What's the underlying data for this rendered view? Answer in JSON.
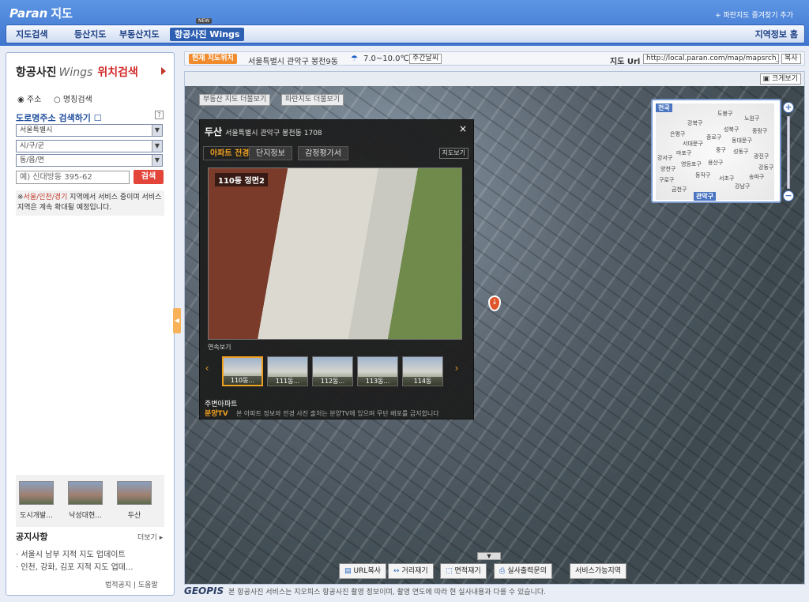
{
  "header": {
    "logo_brand": "Paran",
    "logo_suffix": "지도",
    "favorite_link": "+ 파란지도 즐겨찾기 추가",
    "nav": [
      "지도검색",
      "등산지도",
      "부동산지도",
      "항공사진 Wings"
    ],
    "new_badge": "NEW",
    "region_info": "지역정보 홈"
  },
  "left_panel": {
    "title_a": "항공사진",
    "title_wings": "Wings",
    "title_b": "위치검색",
    "radio_address": "주소",
    "radio_name": "명칭검색",
    "road_search": "도로명주소 검색하기",
    "help": "?",
    "select_city": "서울특별시",
    "select_district": "시/구/군",
    "select_dong": "동/읍/면",
    "address_placeholder": "예) 신대방동 395-62",
    "search_button": "검색",
    "note_prefix": "※",
    "note_red": "서울/인천/경기",
    "note_rest": " 지역에서 서비스 중이며 서비스 지역은 계속 확대될 예정입니다.",
    "thumbnails": [
      "도시개발...",
      "낙성대현...",
      "두산"
    ],
    "notice_title": "공지사항",
    "notice_more": "더보기 ▸",
    "notices": [
      "· 서울시 남부 지적 지도 업데이트",
      "· 인천, 강화, 김포 지적 지도 업데..."
    ],
    "footer_links": [
      "법적공지",
      "도움말"
    ]
  },
  "info_bar": {
    "current_label": "현재 지도위치",
    "location": "서울특별시 관악구 봉천9동",
    "temperature": "7.0~10.0℃",
    "week_weather": "주간날씨",
    "url_label": "지도 Url",
    "url_value": "http://local.paran.com/map/mapsrch_w",
    "copy_button": "복사"
  },
  "map": {
    "big_view": "크게보기",
    "overlay_buttons": [
      "부동산 지도 더불보기",
      "파란지도 더불보기"
    ],
    "popup": {
      "title": "두산",
      "address": "서울특별시 관악구 봉천동 1708",
      "close": "×",
      "tabs": [
        "아파트 전경",
        "단지정보",
        "감정평가서"
      ],
      "map_view": "지도보기",
      "photo_label": "110동 정면2",
      "continuous": "연속보기",
      "thumbs": [
        "110동...",
        "111동...",
        "112동...",
        "113동...",
        "114동"
      ],
      "nearby": "주변아파트",
      "tv_logo": "분양TV",
      "nearby_note": "본 아파트 정보와 전경 사진 출처는 분양TV에 있으며 무단 배포를 금지합니다"
    },
    "minimap": {
      "header": "전국",
      "districts": [
        "도봉구",
        "강북구",
        "노원구",
        "은평구",
        "성북구",
        "중랑구",
        "서대문구",
        "종로구",
        "동대문구",
        "마포구",
        "중구",
        "성동구",
        "광진구",
        "강서구",
        "용산구",
        "양천구",
        "영등포구",
        "강동구",
        "송파구",
        "구로구",
        "금천구",
        "동작구",
        "서초구",
        "강남구"
      ],
      "selected": "관악구"
    },
    "zoom_in": "+",
    "zoom_out": "−",
    "tools": [
      "URL복사",
      "거리재기",
      "면적재기",
      "실사출력문의",
      "서비스가능지역"
    ]
  },
  "footer": {
    "brand": "GEOPIS",
    "text": "본 항공사진 서비스는 지오피스 항공사진 촬영 정보이며, 촬영 연도에 따라 현 실사내용과 다를 수 있습니다."
  }
}
